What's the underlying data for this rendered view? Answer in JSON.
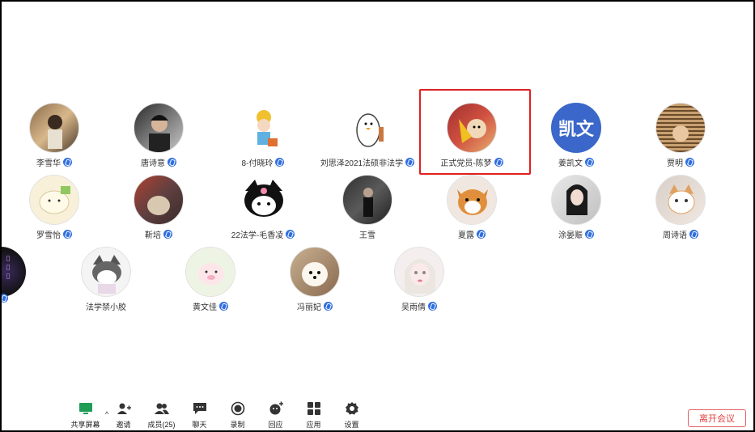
{
  "participants": [
    {
      "name": "李雪华",
      "avatar": "photo-woman-avatar"
    },
    {
      "name": "唐诗意",
      "avatar": "photo-man-avatar"
    },
    {
      "name": "8-付晓玲",
      "avatar": "cartoon-avatar"
    },
    {
      "name": "刘思泽2021法硕非法学",
      "avatar": "duck-cartoon-avatar"
    },
    {
      "name": "正式党员-陈梦",
      "avatar": "photo-dog-avatar"
    },
    {
      "name": "姜凯文",
      "avatar_text": "凯文",
      "avatar": "text-avatar"
    },
    {
      "name": "贾明",
      "avatar": "photo-avatar"
    },
    {
      "name": "罗雪怡",
      "avatar": "cartoon-avatar"
    },
    {
      "name": "靳培",
      "avatar": "photo-avatar"
    },
    {
      "name": "22法学-毛香凌",
      "avatar": "kuromi-avatar"
    },
    {
      "name": "王雪",
      "avatar": "photo-man-avatar"
    },
    {
      "name": "夏露",
      "avatar": "shiba-dog-avatar"
    },
    {
      "name": "涂晏赈",
      "avatar": "photo-woman-avatar"
    },
    {
      "name": "周诗语",
      "avatar": "cat-avatar"
    },
    {
      "name": "法学禁小胶",
      "avatar": "kuromi-avatar"
    },
    {
      "name": "黄文佳",
      "avatar": "pig-cartoon-avatar"
    },
    {
      "name": "冯丽妃",
      "avatar": "dog-avatar"
    },
    {
      "name": "吴雨倩",
      "avatar": "doll-avatar"
    }
  ],
  "toolbar": {
    "share": "共享屏幕",
    "invite": "邀请",
    "members": "成员(25)",
    "chat": "聊天",
    "record": "录制",
    "reactions": "回应",
    "apps": "应用",
    "settings": "设置"
  },
  "leave_label": "离开会议",
  "colors": {
    "accent": "#2f6ee0",
    "highlight": "#e02020",
    "leave": "#e04040"
  }
}
